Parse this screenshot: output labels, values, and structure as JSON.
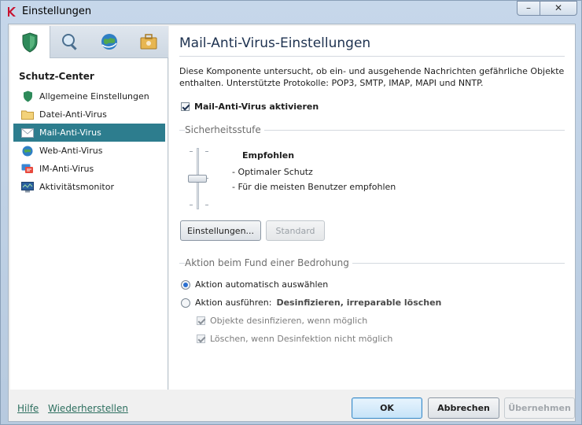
{
  "window": {
    "title": "Einstellungen",
    "minimize_label": "–",
    "close_label": "✕"
  },
  "sidebar": {
    "tabs": [
      {
        "icon": "shield-icon"
      },
      {
        "icon": "magnifier-icon"
      },
      {
        "icon": "globe-icon"
      },
      {
        "icon": "toolbox-icon"
      }
    ],
    "section_title": "Schutz-Center",
    "items": [
      {
        "label": "Allgemeine Einstellungen",
        "icon": "shield-icon"
      },
      {
        "label": "Datei-Anti-Virus",
        "icon": "folder-icon"
      },
      {
        "label": "Mail-Anti-Virus",
        "icon": "mail-icon",
        "selected": true
      },
      {
        "label": "Web-Anti-Virus",
        "icon": "globe-icon"
      },
      {
        "label": "IM-Anti-Virus",
        "icon": "chat-icon"
      },
      {
        "label": "Aktivitätsmonitor",
        "icon": "monitor-icon"
      }
    ]
  },
  "main": {
    "title": "Mail-Anti-Virus-Einstellungen",
    "description": "Diese Komponente untersucht, ob ein- und ausgehende Nachrichten gefährliche Objekte enthalten. Unterstützte Protokolle: POP3, SMTP, IMAP, MAPI und NNTP.",
    "enable_checkbox": {
      "label": "Mail-Anti-Virus aktivieren",
      "checked": true
    },
    "security_group": {
      "title": "Sicherheitsstufe",
      "level_name": "Empfohlen",
      "level_lines": [
        "- Optimaler Schutz",
        "- Für die meisten Benutzer empfohlen"
      ],
      "settings_button": "Einstellungen...",
      "default_button": "Standard"
    },
    "action_group": {
      "title": "Aktion beim Fund einer Bedrohung",
      "radio_auto": "Aktion automatisch auswählen",
      "radio_execute": "Aktion ausführen:",
      "radio_execute_value": "Desinfizieren, irreparable löschen",
      "check_disinfect": "Objekte desinfizieren, wenn möglich",
      "check_delete": "Löschen, wenn Desinfektion nicht möglich"
    }
  },
  "footer": {
    "help_link": "Hilfe",
    "restore_link": "Wiederherstellen",
    "ok_button": "OK",
    "cancel_button": "Abbrechen",
    "apply_button": "Übernehmen"
  },
  "colors": {
    "accent": "#2d7d8e",
    "title_text": "#1e3250",
    "link": "#2d6f5f"
  }
}
